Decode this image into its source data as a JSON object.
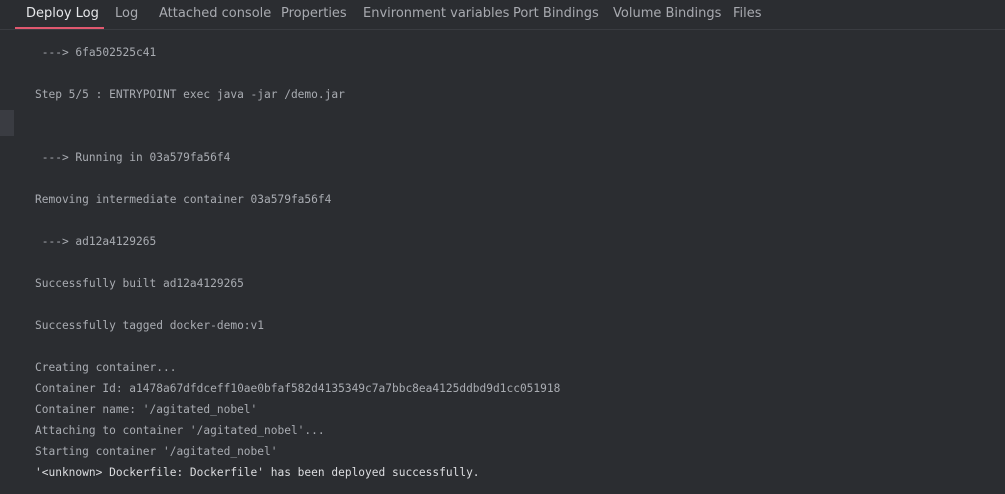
{
  "tabs": [
    {
      "label": "Deploy Log",
      "active": true
    },
    {
      "label": "Log",
      "active": false
    },
    {
      "label": "Attached console",
      "active": false
    },
    {
      "label": "Properties",
      "active": false
    },
    {
      "label": "Environment variables",
      "active": false
    },
    {
      "label": "Port Bindings",
      "active": false
    },
    {
      "label": "Volume Bindings",
      "active": false
    },
    {
      "label": "Files",
      "active": false
    }
  ],
  "log": {
    "lines": [
      " ---> 6fa502525c41",
      "Step 5/5 : ENTRYPOINT exec java -jar /demo.jar",
      " ---> Running in 03a579fa56f4",
      "Removing intermediate container 03a579fa56f4",
      " ---> ad12a4129265",
      "Successfully built ad12a4129265",
      "Successfully tagged docker-demo:v1",
      "Creating container...",
      "Container Id: a1478a67dfdceff10ae0bfaf582d4135349c7a7bbc8ea4125ddbd9d1cc051918",
      "Container name: '/agitated_nobel'",
      "Attaching to container '/agitated_nobel'...",
      "Starting container '/agitated_nobel'",
      "'<unknown> Dockerfile: Dockerfile' has been deployed successfully."
    ]
  },
  "colors": {
    "background": "#2b2d31",
    "active_tab_underline": "#e0586f",
    "text": "#a9acb2"
  }
}
